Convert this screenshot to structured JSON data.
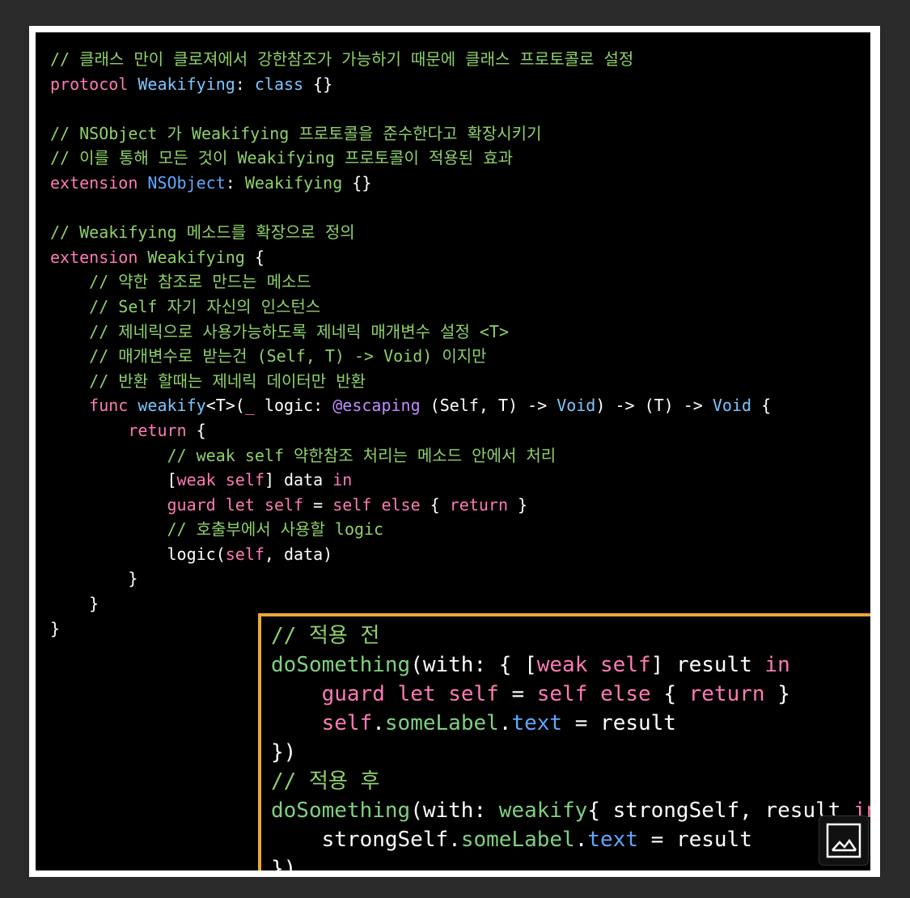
{
  "colors": {
    "background": "#2a2a2a",
    "frame": "#ffffff",
    "editor_bg": "#000000",
    "inset_border": "#e8a93a",
    "comment": "#8fd16a",
    "keyword": "#ff7ab6",
    "type": "#7cc6ff",
    "function": "#7fd17f",
    "attribute": "#c28cff",
    "plain": "#ffffff"
  },
  "main_code": {
    "lines": [
      [
        {
          "t": "// 클래스 만이 클로져에서 강한참조가 가능하기 때문에 클래스 프로토콜로 설정",
          "c": "comment"
        }
      ],
      [
        {
          "t": "protocol",
          "c": "keyword"
        },
        {
          "t": " ",
          "c": "plain"
        },
        {
          "t": "Weakifying",
          "c": "type"
        },
        {
          "t": ": ",
          "c": "plain"
        },
        {
          "t": "class",
          "c": "type"
        },
        {
          "t": " {}",
          "c": "plain"
        }
      ],
      [],
      [
        {
          "t": "// NSObject 가 Weakifying 프로토콜을 준수한다고 확장시키기",
          "c": "comment"
        }
      ],
      [
        {
          "t": "// 이를 통해 모든 것이 Weakifying 프로토콜이 적용된 효과",
          "c": "comment"
        }
      ],
      [
        {
          "t": "extension",
          "c": "keyword"
        },
        {
          "t": " ",
          "c": "plain"
        },
        {
          "t": "NSObject",
          "c": "blue"
        },
        {
          "t": ": ",
          "c": "plain"
        },
        {
          "t": "Weakifying",
          "c": "green"
        },
        {
          "t": " {}",
          "c": "plain"
        }
      ],
      [],
      [
        {
          "t": "// Weakifying 메소드를 확장으로 정의",
          "c": "comment"
        }
      ],
      [
        {
          "t": "extension",
          "c": "keyword"
        },
        {
          "t": " ",
          "c": "plain"
        },
        {
          "t": "Weakifying",
          "c": "green"
        },
        {
          "t": " {",
          "c": "plain"
        }
      ],
      [
        {
          "t": "    // 약한 참조로 만드는 메소드",
          "c": "comment"
        }
      ],
      [
        {
          "t": "    // Self 자기 자신의 인스턴스",
          "c": "comment"
        }
      ],
      [
        {
          "t": "    // 제네릭으로 사용가능하도록 제네릭 매개변수 설정 <T>",
          "c": "comment"
        }
      ],
      [
        {
          "t": "    // 매개변수로 받는건 (Self, T) -> Void) 이지만",
          "c": "comment"
        }
      ],
      [
        {
          "t": "    // 반환 할때는 제네릭 데이터만 반환",
          "c": "comment"
        }
      ],
      [
        {
          "t": "    ",
          "c": "plain"
        },
        {
          "t": "func",
          "c": "keyword"
        },
        {
          "t": " ",
          "c": "plain"
        },
        {
          "t": "weakify",
          "c": "type"
        },
        {
          "t": "<T>(",
          "c": "plain"
        },
        {
          "t": "_",
          "c": "keyword"
        },
        {
          "t": " logic: ",
          "c": "plain"
        },
        {
          "t": "@escaping",
          "c": "attr"
        },
        {
          "t": " (Self, T) -> ",
          "c": "plain"
        },
        {
          "t": "Void",
          "c": "type"
        },
        {
          "t": ") -> (T) -> ",
          "c": "plain"
        },
        {
          "t": "Void",
          "c": "type"
        },
        {
          "t": " {",
          "c": "plain"
        }
      ],
      [
        {
          "t": "        ",
          "c": "plain"
        },
        {
          "t": "return",
          "c": "keyword"
        },
        {
          "t": " {",
          "c": "plain"
        }
      ],
      [
        {
          "t": "            // weak self 약한참조 처리는 메소드 안에서 처리",
          "c": "comment"
        }
      ],
      [
        {
          "t": "            [",
          "c": "plain"
        },
        {
          "t": "weak",
          "c": "keyword"
        },
        {
          "t": " ",
          "c": "plain"
        },
        {
          "t": "self",
          "c": "keyword"
        },
        {
          "t": "] data ",
          "c": "plain"
        },
        {
          "t": "in",
          "c": "keyword"
        }
      ],
      [
        {
          "t": "            ",
          "c": "plain"
        },
        {
          "t": "guard",
          "c": "keyword"
        },
        {
          "t": " ",
          "c": "plain"
        },
        {
          "t": "let",
          "c": "keyword"
        },
        {
          "t": " ",
          "c": "plain"
        },
        {
          "t": "self",
          "c": "keyword"
        },
        {
          "t": " = ",
          "c": "plain"
        },
        {
          "t": "self",
          "c": "keyword"
        },
        {
          "t": " ",
          "c": "plain"
        },
        {
          "t": "else",
          "c": "keyword"
        },
        {
          "t": " { ",
          "c": "plain"
        },
        {
          "t": "return",
          "c": "keyword"
        },
        {
          "t": " }",
          "c": "plain"
        }
      ],
      [
        {
          "t": "            // 호출부에서 사용할 logic",
          "c": "comment"
        }
      ],
      [
        {
          "t": "            logic(",
          "c": "plain"
        },
        {
          "t": "self",
          "c": "keyword"
        },
        {
          "t": ", data)",
          "c": "plain"
        }
      ],
      [
        {
          "t": "        }",
          "c": "plain"
        }
      ],
      [
        {
          "t": "    }",
          "c": "plain"
        }
      ],
      [
        {
          "t": "}",
          "c": "plain"
        }
      ]
    ]
  },
  "inset_code": {
    "lines": [
      [
        {
          "t": "// 적용 전",
          "c": "comment"
        }
      ],
      [
        {
          "t": "doSomething",
          "c": "func"
        },
        {
          "t": "(with: { [",
          "c": "plain"
        },
        {
          "t": "weak",
          "c": "keyword"
        },
        {
          "t": " ",
          "c": "plain"
        },
        {
          "t": "self",
          "c": "keyword"
        },
        {
          "t": "] result ",
          "c": "plain"
        },
        {
          "t": "in",
          "c": "keyword"
        }
      ],
      [
        {
          "t": "    ",
          "c": "plain"
        },
        {
          "t": "guard",
          "c": "keyword"
        },
        {
          "t": " ",
          "c": "plain"
        },
        {
          "t": "let",
          "c": "keyword"
        },
        {
          "t": " ",
          "c": "plain"
        },
        {
          "t": "self",
          "c": "keyword"
        },
        {
          "t": " = ",
          "c": "plain"
        },
        {
          "t": "self",
          "c": "keyword"
        },
        {
          "t": " ",
          "c": "plain"
        },
        {
          "t": "else",
          "c": "keyword"
        },
        {
          "t": " { ",
          "c": "plain"
        },
        {
          "t": "return",
          "c": "keyword"
        },
        {
          "t": " }",
          "c": "plain"
        }
      ],
      [
        {
          "t": "    ",
          "c": "plain"
        },
        {
          "t": "self",
          "c": "keyword"
        },
        {
          "t": ".",
          "c": "plain"
        },
        {
          "t": "someLabel",
          "c": "func"
        },
        {
          "t": ".",
          "c": "plain"
        },
        {
          "t": "text",
          "c": "blue"
        },
        {
          "t": " = result",
          "c": "plain"
        }
      ],
      [
        {
          "t": "})",
          "c": "plain"
        }
      ],
      [
        {
          "t": "// 적용 후",
          "c": "comment"
        }
      ],
      [
        {
          "t": "doSomething",
          "c": "func"
        },
        {
          "t": "(with: ",
          "c": "plain"
        },
        {
          "t": "weakify",
          "c": "func"
        },
        {
          "t": "{ strongSelf, result ",
          "c": "plain"
        },
        {
          "t": "in",
          "c": "keyword"
        }
      ],
      [
        {
          "t": "    strongSelf.",
          "c": "plain"
        },
        {
          "t": "someLabel",
          "c": "func"
        },
        {
          "t": ".",
          "c": "plain"
        },
        {
          "t": "text",
          "c": "blue"
        },
        {
          "t": " = result",
          "c": "plain"
        }
      ],
      [
        {
          "t": "})",
          "c": "plain"
        }
      ]
    ]
  },
  "image_button": {
    "icon": "image-icon"
  }
}
